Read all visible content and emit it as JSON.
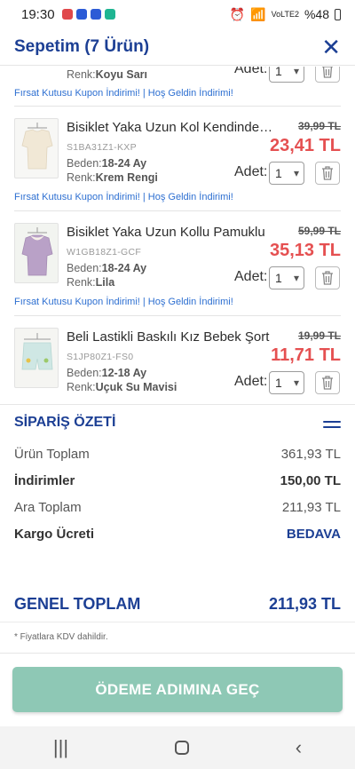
{
  "status_bar": {
    "time": "19:30",
    "network": "VoLTE2",
    "battery": "%48"
  },
  "header": {
    "title": "Sepetim (7 Ürün)",
    "close_icon": "close-icon"
  },
  "partial_item": {
    "color_label": "Renk:",
    "color_value": "Koyu Sarı",
    "qty_label": "Adet:",
    "qty_value": "1"
  },
  "coupon_text": "Fırsat Kutusu Kupon İndirimi! | Hoş Geldin İndirimi!",
  "items": [
    {
      "name": "Bisiklet Yaka Uzun Kol Kendinden Desenli",
      "sku": "S1BA31Z1-KXP",
      "size_label": "Beden:",
      "size": "18-24 Ay",
      "color_label": "Renk:",
      "color": "Krem Rengi",
      "old_price": "39,99 TL",
      "price": "23,41 TL",
      "qty_label": "Adet:",
      "qty": "1"
    },
    {
      "name": "Bisiklet Yaka Uzun Kollu Pamuklu",
      "sku": "W1GB18Z1-GCF",
      "size_label": "Beden:",
      "size": "18-24 Ay",
      "color_label": "Renk:",
      "color": "Lila",
      "old_price": "59,99 TL",
      "price": "35,13 TL",
      "qty_label": "Adet:",
      "qty": "1"
    },
    {
      "name": "Beli Lastikli Baskılı Kız Bebek Şort",
      "sku": "S1JP80Z1-FS0",
      "size_label": "Beden:",
      "size": "12-18 Ay",
      "color_label": "Renk:",
      "color": "Uçuk Su Mavisi",
      "old_price": "19,99 TL",
      "price": "11,71 TL",
      "qty_label": "Adet:",
      "qty": "1"
    }
  ],
  "summary": {
    "title": "SİPARİŞ ÖZETİ",
    "rows": [
      {
        "label": "Ürün Toplam",
        "value": "361,93 TL"
      },
      {
        "label": "İndirimler",
        "value": "150,00 TL"
      },
      {
        "label": "Ara Toplam",
        "value": "211,93 TL"
      },
      {
        "label": "Kargo Ücreti",
        "value": "BEDAVA"
      }
    ],
    "grand_label": "GENEL TOPLAM",
    "grand_value": "211,93 TL",
    "vat_note": "* Fiyatlara KDV dahildir."
  },
  "pay_button": "ÖDEME ADIMINA GEÇ",
  "colors": {
    "brand_blue": "#1c3f94",
    "price_red": "#e55051",
    "coupon_blue": "#2d6fd1",
    "button_green": "#8ec8b5"
  }
}
